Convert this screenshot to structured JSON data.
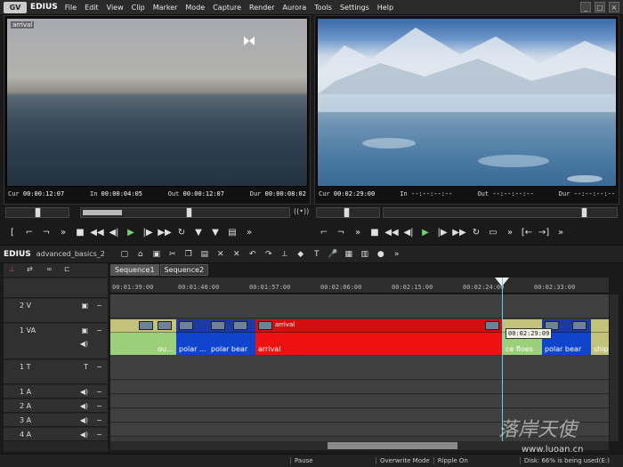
{
  "app": {
    "name": "EDIUS",
    "logo_text": "GV"
  },
  "menu": [
    "File",
    "Edit",
    "View",
    "Clip",
    "Marker",
    "Mode",
    "Capture",
    "Render",
    "Aurora",
    "Tools",
    "Settings",
    "Help"
  ],
  "window_buttons": [
    "_",
    "□",
    "×"
  ],
  "player": {
    "clip_name": "arrival",
    "cur_label": "Cur",
    "cur": "00:00:12:07",
    "in_label": "In",
    "in": "00:00:04:05",
    "out_label": "Out",
    "out": "00:00:12:07",
    "dur_label": "Dur",
    "dur": "00:00:08:02"
  },
  "recorder": {
    "cur_label": "Cur",
    "cur": "00:02:29:00",
    "in_label": "In",
    "in": "--:--:--:--",
    "out_label": "Out",
    "out": "--:--:--:--",
    "dur_label": "Dur",
    "dur": "--:--:--:--"
  },
  "edius_row": {
    "brand": "EDIUS",
    "project": "advanced_basics_2"
  },
  "sequence_tabs": [
    "Sequence1",
    "Sequence2"
  ],
  "ruler_ticks": [
    "00:01:39:00",
    "00:01:48:00",
    "00:01:57:00",
    "00:02:06:00",
    "00:02:15:00",
    "00:02:24:00",
    "00:02:33:00"
  ],
  "tracks": [
    {
      "label": "2 V"
    },
    {
      "label": "1 VA"
    },
    {
      "label": "1 T"
    },
    {
      "label": "1 A"
    },
    {
      "label": "2 A"
    },
    {
      "label": "3 A"
    },
    {
      "label": "4 A"
    }
  ],
  "clips": [
    {
      "label": "",
      "top_label": ""
    },
    {
      "label": "ou...",
      "top_label": ""
    },
    {
      "label": "polar ...",
      "top_label": ""
    },
    {
      "label": "polar bear",
      "top_label": ""
    },
    {
      "label": "arrival",
      "top_label": "arrival"
    },
    {
      "label": "ce floes",
      "top_label": ""
    },
    {
      "label": "polar bear",
      "top_label": ""
    },
    {
      "label": "ship",
      "top_label": ""
    }
  ],
  "tooltip": "00:02:29:09",
  "status": {
    "pause": "Pause",
    "mode": "Overwrite Mode",
    "ripple": "Ripple On",
    "disk": "Disk: 66% is being used(E:)"
  },
  "watermark": {
    "text": "落岸天使",
    "url": "www.luoan.cn"
  },
  "colors": {
    "clip_red": "#ee1111",
    "clip_blue": "#1144cc",
    "clip_green": "#9ccf7a",
    "playhead": "#5fd0e6"
  }
}
